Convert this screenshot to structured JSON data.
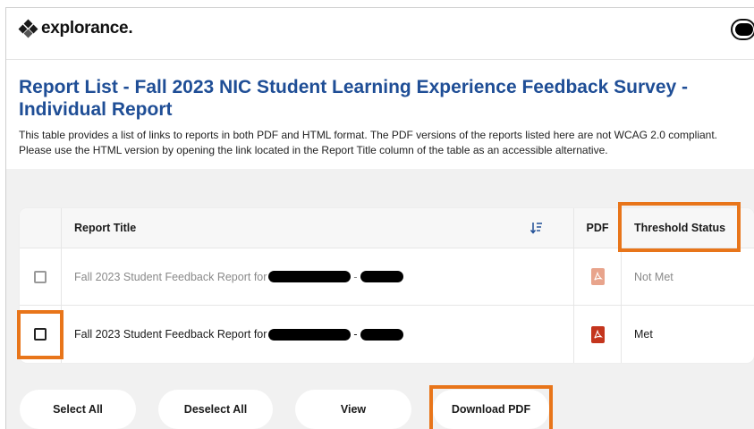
{
  "header": {
    "logo_text": "explorance."
  },
  "page": {
    "title": "Report List - Fall 2023 NIC Student Learning Experience Feedback Survey - Individual Report",
    "description_line1": "This table provides a list of links to reports in both PDF and HTML format. The PDF versions of the reports listed here are not WCAG 2.0 compliant.",
    "description_line2": "Please use the HTML version by opening the link located in the Report Title column of the table as an accessible alternative."
  },
  "table": {
    "columns": {
      "report_title": "Report Title",
      "pdf": "PDF",
      "threshold_status": "Threshold Status"
    },
    "rows": [
      {
        "title_prefix": "Fall 2023 Student Feedback Report for",
        "separator": "-",
        "status": "Not Met",
        "checked": false
      },
      {
        "title_prefix": "Fall 2023 Student Feedback Report for",
        "separator": "-",
        "status": "Met",
        "checked": false
      }
    ]
  },
  "actions": {
    "select_all": "Select All",
    "deselect_all": "Deselect All",
    "view": "View",
    "download_pdf": "Download PDF"
  },
  "colors": {
    "title_blue": "#1f4e96",
    "highlight_orange": "#e8751a",
    "pdf_red": "#c4351d",
    "pdf_red_faded": "#e8a48c"
  },
  "icons": {
    "logo": "explorance-diamonds-icon",
    "toggle": "toggle-icon",
    "sort": "sort-descending-icon",
    "pdf": "pdf-file-icon"
  }
}
